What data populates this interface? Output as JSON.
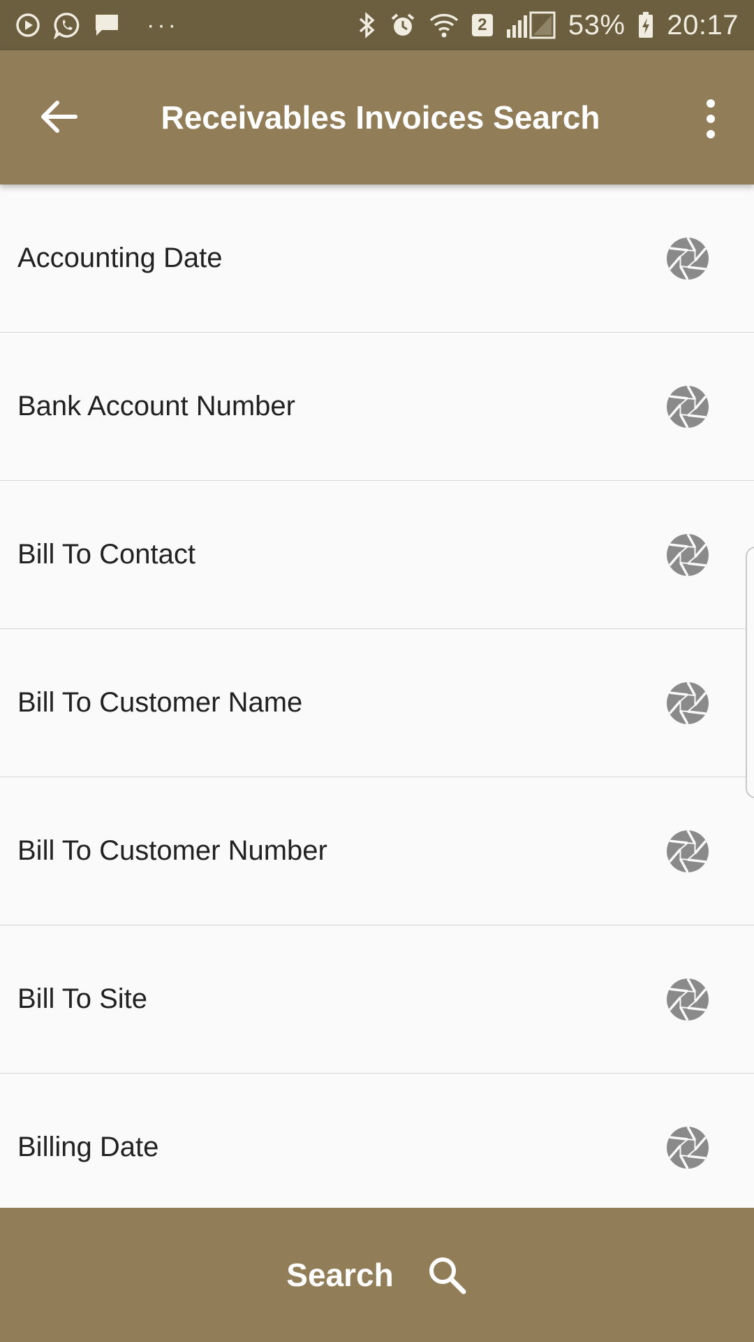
{
  "status_bar": {
    "left_icons": [
      "play-circle-icon",
      "whatsapp-icon",
      "message-icon",
      "more-dots-icon"
    ],
    "dots": "···",
    "right_icons": [
      "bluetooth-icon",
      "alarm-icon",
      "wifi-icon",
      "sim-2-icon",
      "signal-icon"
    ],
    "sim_badge": "2",
    "battery_percent": "53%",
    "time": "20:17"
  },
  "app_bar": {
    "title": "Receivables Invoices Search",
    "back_icon": "arrow-back-icon",
    "menu_icon": "more-vert-icon"
  },
  "search_fields": [
    {
      "label": "Accounting Date",
      "icon": "aperture-icon"
    },
    {
      "label": "Bank Account Number",
      "icon": "aperture-icon"
    },
    {
      "label": "Bill To Contact",
      "icon": "aperture-icon"
    },
    {
      "label": "Bill To Customer Name",
      "icon": "aperture-icon"
    },
    {
      "label": "Bill To Customer Number",
      "icon": "aperture-icon"
    },
    {
      "label": "Bill To Site",
      "icon": "aperture-icon"
    },
    {
      "label": "Billing Date",
      "icon": "aperture-icon"
    }
  ],
  "bottom_bar": {
    "search_label": "Search",
    "icon": "search-icon"
  },
  "colors": {
    "status_bar": "#6b5f40",
    "primary": "#917d57",
    "background": "#fafafa",
    "icon_gray": "#8a8a8a"
  }
}
